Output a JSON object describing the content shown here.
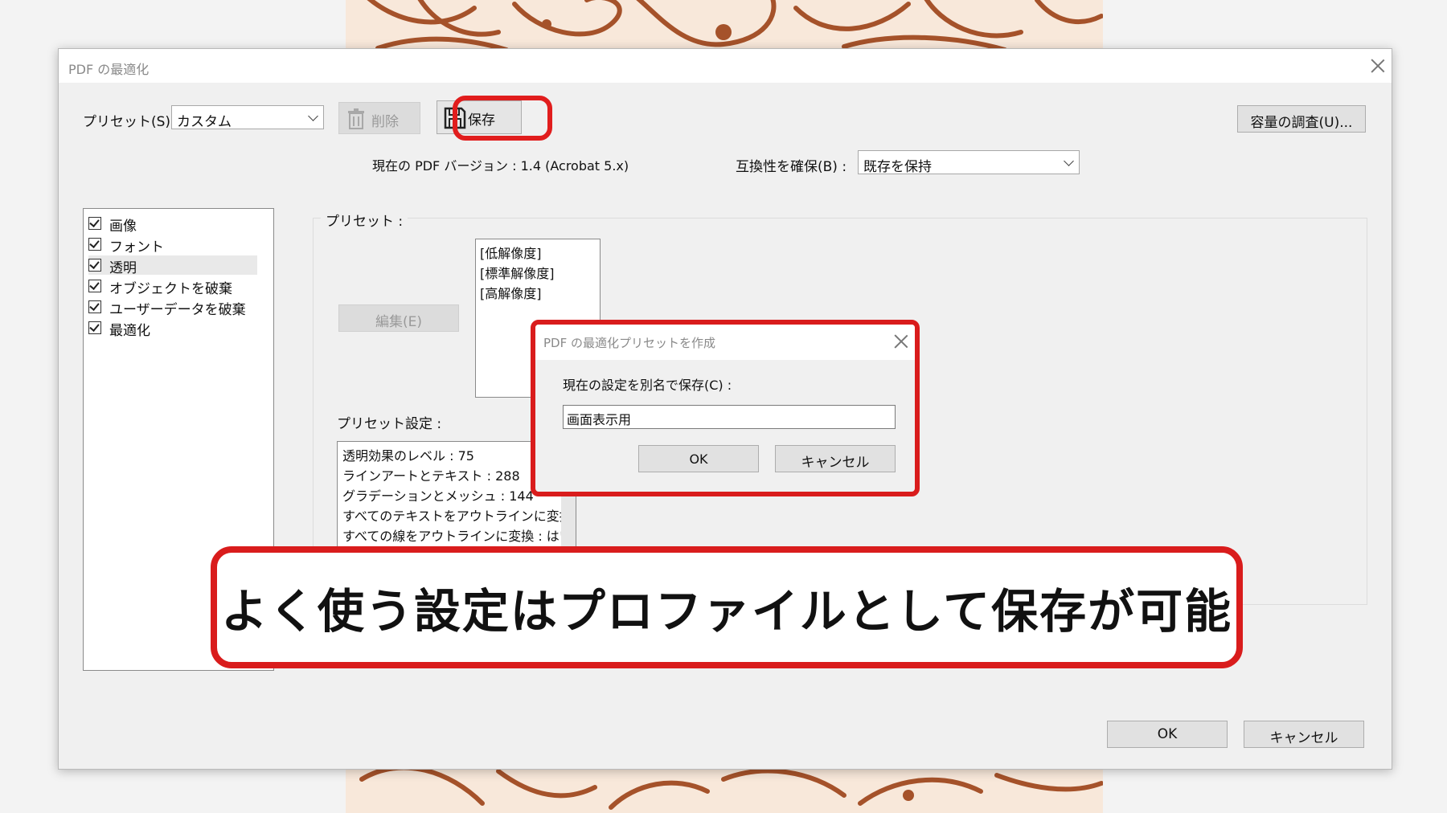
{
  "main_dialog": {
    "title": "PDF の最適化",
    "preset_label": "プリセット(S) :",
    "preset_value": "カスタム",
    "delete_label": "削除",
    "save_label": "保存",
    "audit_label": "容量の調査(U)...",
    "pdf_version_text": "現在の PDF バージョン : 1.4 (Acrobat 5.x)",
    "compat_label": "互換性を確保(B) :",
    "compat_value": "既存を保持",
    "ok_label": "OK",
    "cancel_label": "キャンセル"
  },
  "categories": [
    {
      "label": "画像",
      "checked": true
    },
    {
      "label": "フォント",
      "checked": true
    },
    {
      "label": "透明",
      "checked": true,
      "selected": true
    },
    {
      "label": "オブジェクトを破棄",
      "checked": true
    },
    {
      "label": "ユーザーデータを破棄",
      "checked": true
    },
    {
      "label": "最適化",
      "checked": true
    }
  ],
  "presets_panel": {
    "group_label": "プリセット :",
    "edit_label": "編集(E)",
    "preset_list": [
      "[低解像度]",
      "[標準解像度]",
      "[高解像度]"
    ],
    "settings_label": "プリセット設定 :",
    "settings_lines": [
      "透明効果のレベル : 75",
      "ラインアートとテキスト : 288",
      "グラデーションとメッシュ : 144",
      "すべてのテキストをアウトラインに変換 :",
      "すべての線をアウトラインに変換 : はい"
    ]
  },
  "save_preset_dialog": {
    "title": "PDF の最適化プリセットを作成",
    "prompt": "現在の設定を別名で保存(C) :",
    "name_value": "画面表示用",
    "ok_label": "OK",
    "cancel_label": "キャンセル"
  },
  "caption": {
    "text": "よく使う設定はプロファイルとして保存が可能"
  },
  "colors": {
    "highlight_red": "#d91c1c",
    "art_line": "#a5522a",
    "art_bg": "#f8e8da"
  }
}
